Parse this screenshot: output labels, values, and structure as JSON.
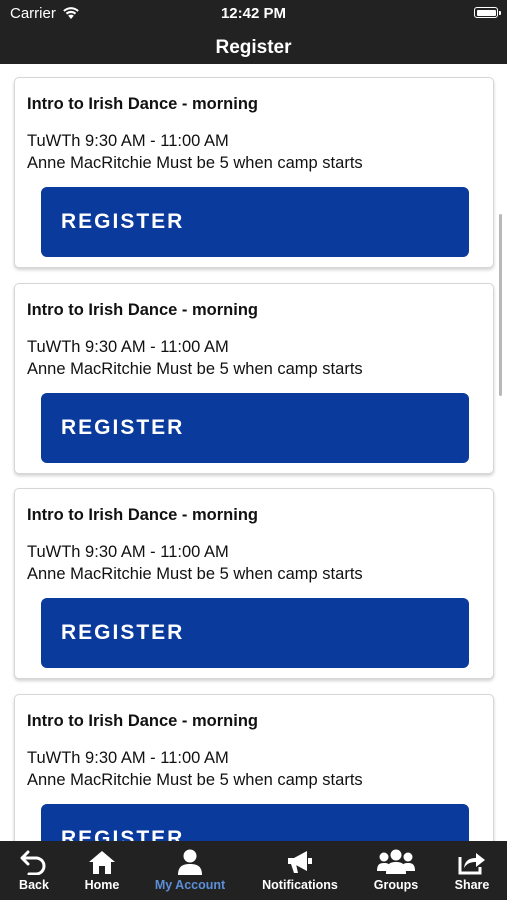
{
  "status_bar": {
    "carrier": "Carrier",
    "time": "12:42 PM"
  },
  "nav": {
    "title": "Register"
  },
  "cards": [
    {
      "title": "Intro to Irish Dance - morning",
      "schedule": "TuWTh 9:30 AM - 11:00 AM",
      "instructor_note": "Anne MacRitchie Must be 5 when camp starts",
      "button_label": "REGISTER"
    },
    {
      "title": "Intro to Irish Dance - morning",
      "schedule": "TuWTh 9:30 AM - 11:00 AM",
      "instructor_note": "Anne MacRitchie Must be 5 when camp starts",
      "button_label": "REGISTER"
    },
    {
      "title": "Intro to Irish Dance - morning",
      "schedule": "TuWTh 9:30 AM - 11:00 AM",
      "instructor_note": "Anne MacRitchie Must be 5 when camp starts",
      "button_label": "REGISTER"
    },
    {
      "title": "Intro to Irish Dance - morning",
      "schedule": "TuWTh 9:30 AM - 11:00 AM",
      "instructor_note": "Anne MacRitchie Must be 5 when camp starts",
      "button_label": "REGISTER"
    }
  ],
  "tab_bar": {
    "items": [
      {
        "label": "Back",
        "icon": "back-arrow-icon"
      },
      {
        "label": "Home",
        "icon": "home-icon"
      },
      {
        "label": "My Account",
        "icon": "user-icon",
        "active": true
      },
      {
        "label": "Notifications",
        "icon": "megaphone-icon"
      },
      {
        "label": "Groups",
        "icon": "groups-icon"
      },
      {
        "label": "Share",
        "icon": "share-icon"
      }
    ]
  },
  "colors": {
    "bar_background": "#222222",
    "button_primary": "#0a3a9c",
    "tab_active": "#5b8fd8"
  }
}
